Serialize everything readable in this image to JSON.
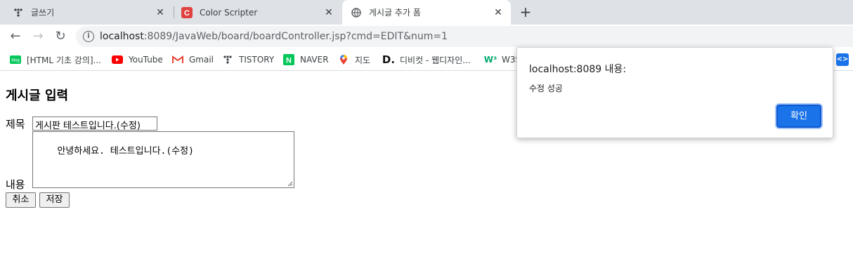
{
  "tabs": [
    {
      "title": "글쓰기",
      "icon": "tistory-icon"
    },
    {
      "title": "Color Scripter",
      "icon": "color-scripter-icon"
    },
    {
      "title": "게시글 추가 폼",
      "icon": "globe-icon"
    }
  ],
  "toolbar": {
    "url_host": "localhost",
    "url_rest": ":8089/JavaWeb/board/boardController.jsp?cmd=EDIT&num=1"
  },
  "bookmarks": [
    {
      "label": "[HTML 기초 강의]...",
      "icon": "blog-icon"
    },
    {
      "label": "YouTube",
      "icon": "youtube-icon"
    },
    {
      "label": "Gmail",
      "icon": "gmail-icon"
    },
    {
      "label": "TISTORY",
      "icon": "tistory-icon"
    },
    {
      "label": "NAVER",
      "icon": "naver-icon"
    },
    {
      "label": "지도",
      "icon": "maps-icon"
    },
    {
      "label": "디비컷 - 웹디자인...",
      "icon": "dbcut-icon"
    },
    {
      "label": "W3S",
      "icon": "w3schools-icon"
    }
  ],
  "page": {
    "heading": "게시글 입력",
    "title_label": "제목",
    "title_value": "게시판 테스트입니다.(수정)",
    "content_label": "내용",
    "content_value": "안녕하세요. 테스트입니다.(수정)",
    "cancel_label": "취소",
    "save_label": "저장"
  },
  "dialog": {
    "title": "localhost:8089 내용:",
    "message": "수정 성공",
    "ok_label": "확인"
  },
  "colors": {
    "accent": "#1a73e8",
    "tabstrip": "#dee1e6"
  }
}
